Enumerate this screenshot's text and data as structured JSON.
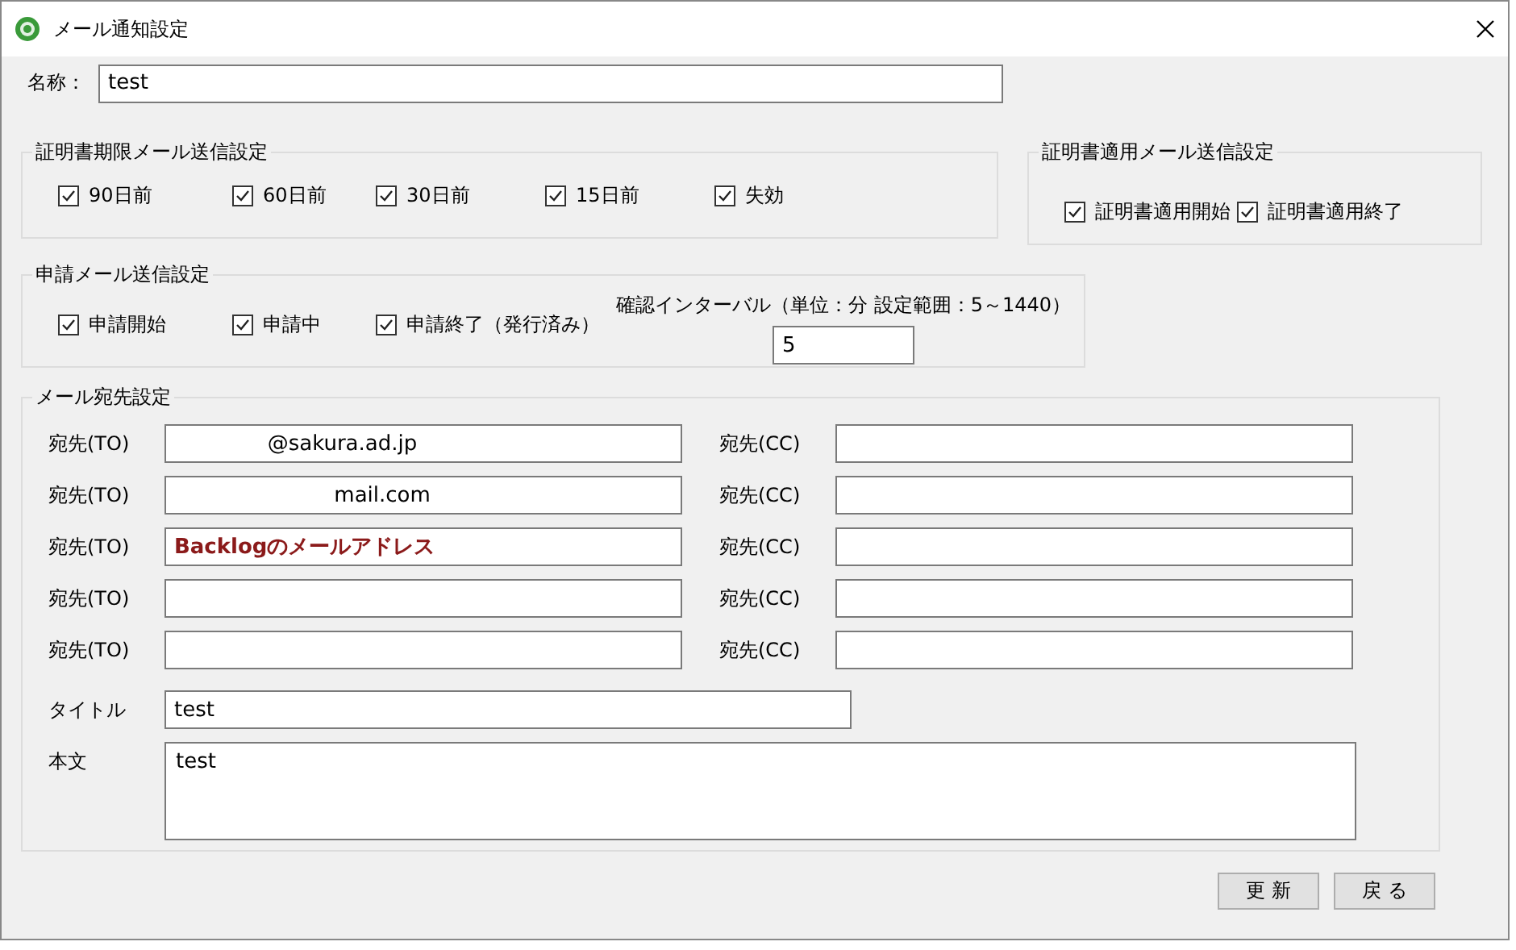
{
  "window": {
    "title": "メール通知設定"
  },
  "name": {
    "label": "名称：",
    "value": "test"
  },
  "expiry_group": {
    "title": "証明書期限メール送信設定",
    "items": [
      {
        "label": "90日前",
        "checked": true
      },
      {
        "label": "60日前",
        "checked": true
      },
      {
        "label": "30日前",
        "checked": true
      },
      {
        "label": "15日前",
        "checked": true
      },
      {
        "label": "失効",
        "checked": true
      }
    ]
  },
  "apply_group": {
    "title": "証明書適用メール送信設定",
    "items": [
      {
        "label": "証明書適用開始",
        "checked": true
      },
      {
        "label": "証明書適用終了",
        "checked": true
      }
    ]
  },
  "application_group": {
    "title": "申請メール送信設定",
    "items": [
      {
        "label": "申請開始",
        "checked": true
      },
      {
        "label": "申請中",
        "checked": true
      },
      {
        "label": "申請終了（発行済み）",
        "checked": true
      }
    ],
    "interval": {
      "label": "確認インターバル（単位：分 設定範囲：5～1440）",
      "value": "5"
    }
  },
  "recipients": {
    "title": "メール宛先設定",
    "rows": [
      {
        "to_label": "宛先(TO)",
        "to_value": "              @sakura.ad.jp",
        "to_emphasis": false,
        "cc_label": "宛先(CC)"
      },
      {
        "to_label": "宛先(TO)",
        "to_value": "                        mail.com",
        "to_emphasis": false,
        "cc_label": "宛先(CC)"
      },
      {
        "to_label": "宛先(TO)",
        "to_value": "Backlogのメールアドレス",
        "to_emphasis": true,
        "cc_label": "宛先(CC)"
      },
      {
        "to_label": "宛先(TO)",
        "cc_label": "宛先(CC)"
      },
      {
        "to_label": "宛先(TO)",
        "cc_label": "宛先(CC)"
      }
    ],
    "subject": {
      "label": "タイトル",
      "value": "test"
    },
    "body": {
      "label": "本文",
      "value": "test"
    }
  },
  "buttons": [
    "更 新",
    "戻 る"
  ]
}
